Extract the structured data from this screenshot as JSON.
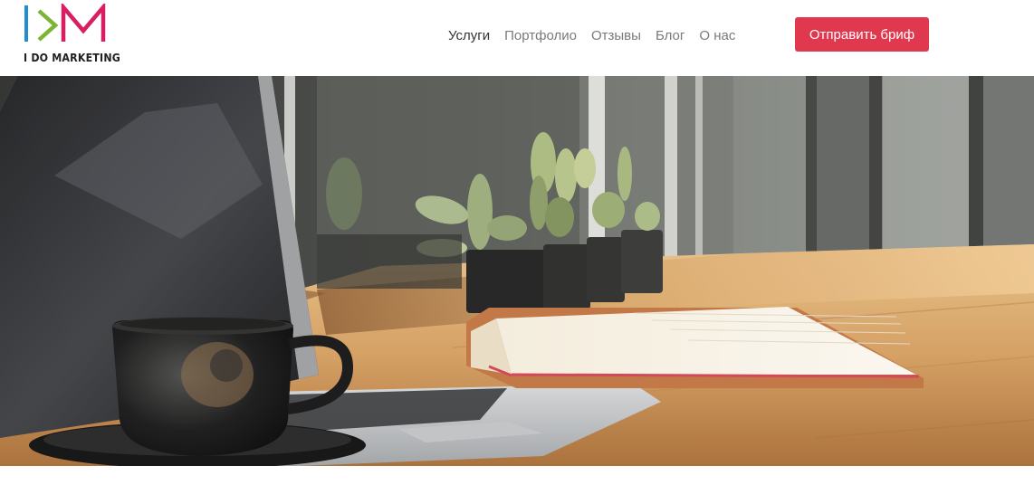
{
  "header": {
    "logo_text": "I DO MARKETING",
    "nav": [
      {
        "label": "Услуги",
        "active": true
      },
      {
        "label": "Портфолио",
        "active": false
      },
      {
        "label": "Отзывы",
        "active": false
      },
      {
        "label": "Блог",
        "active": false
      },
      {
        "label": "О нас",
        "active": false
      }
    ],
    "cta_label": "Отправить бриф"
  },
  "colors": {
    "accent": "#e0384f",
    "logo_blue": "#1f8fd1",
    "logo_green": "#7ab533",
    "logo_pink": "#d81f63"
  },
  "hero": {
    "image": "workspace-photo-laptop-coffee-cactus-book"
  }
}
